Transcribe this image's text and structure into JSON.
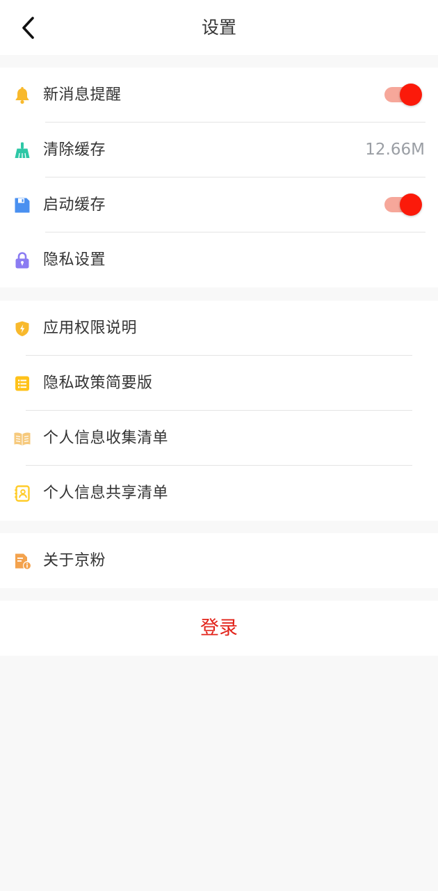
{
  "header": {
    "title": "设置",
    "back_icon": "chevron-left-icon"
  },
  "group1": {
    "items": [
      {
        "label": "新消息提醒",
        "icon": "bell-icon",
        "icon_color": "#f8b92c",
        "control": "toggle",
        "toggle_on": true
      },
      {
        "label": "清除缓存",
        "icon": "broom-icon",
        "icon_color": "#2dc7a6",
        "value": "12.66M"
      },
      {
        "label": "启动缓存",
        "icon": "save-icon",
        "icon_color": "#4a90f0",
        "control": "toggle",
        "toggle_on": true
      },
      {
        "label": "隐私设置",
        "icon": "lock-icon",
        "icon_color": "#8b7cf2"
      }
    ]
  },
  "group2": {
    "items": [
      {
        "label": "应用权限说明",
        "icon": "shield-icon",
        "icon_color": "#f8b92c"
      },
      {
        "label": "隐私政策简要版",
        "icon": "list-icon",
        "icon_color": "#ffc21a"
      },
      {
        "label": "个人信息收集清单",
        "icon": "book-icon",
        "icon_color": "#f6c97c"
      },
      {
        "label": "个人信息共享清单",
        "icon": "contact-card-icon",
        "icon_color": "#ffcc2a"
      }
    ]
  },
  "group3": {
    "items": [
      {
        "label": "关于京粉",
        "icon": "info-document-icon",
        "icon_color": "#f3a24d"
      }
    ]
  },
  "login": {
    "label": "登录",
    "color": "#e2231a"
  },
  "colors": {
    "toggle_knob": "#fb1a0a",
    "toggle_track": "#f6a79a",
    "background": "#f8f8f8"
  }
}
